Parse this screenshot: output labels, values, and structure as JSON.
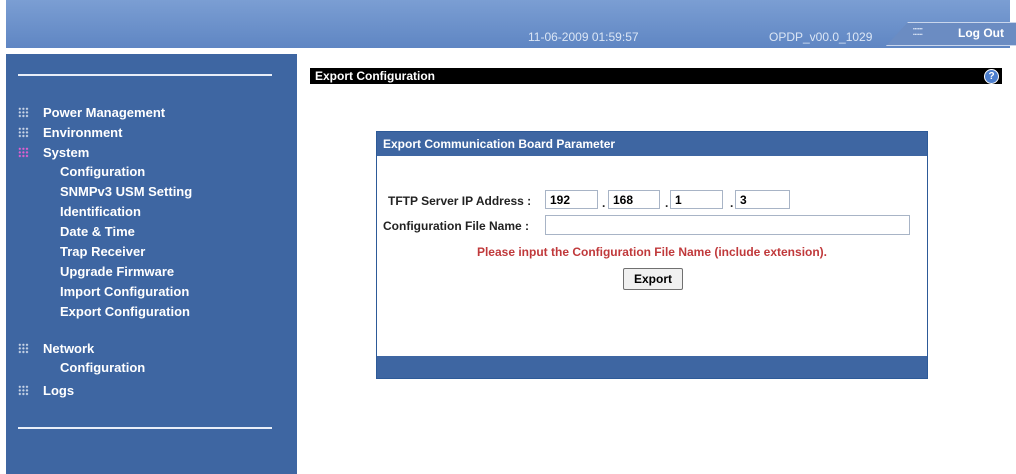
{
  "header": {
    "datetime": "11-06-2009 01:59:57",
    "version": "OPDP_v00.0_1029",
    "logout_dots": "::::::",
    "logout_label": "Log Out"
  },
  "sidebar": {
    "menu": [
      {
        "label": "Power Management"
      },
      {
        "label": "Environment"
      },
      {
        "label": "System",
        "active": true,
        "items": [
          "Configuration",
          "SNMPv3 USM Setting",
          "Identification",
          "Date & Time",
          "Trap Receiver",
          "Upgrade Firmware",
          "Import Configuration",
          "Export Configuration"
        ]
      },
      {
        "label": "Network",
        "items": [
          "Configuration"
        ]
      },
      {
        "label": "Logs"
      }
    ]
  },
  "main": {
    "title": "Export Configuration",
    "help_icon": "?",
    "panel": {
      "title": "Export Communication Board Parameter",
      "tftp_label": "TFTP Server IP Address :",
      "ip": [
        "192",
        "168",
        "1",
        "3"
      ],
      "ip_separator": ".",
      "filename_label": "Configuration File Name :",
      "filename_value": "",
      "hint": "Please input the Configuration File Name (include extension).",
      "export_label": "Export"
    }
  },
  "colors": {
    "sidebar_bg": "#3e66a2",
    "header_bg": "#6f94cd",
    "hint": "#c0393b",
    "active_icon": "#e15fd0"
  }
}
